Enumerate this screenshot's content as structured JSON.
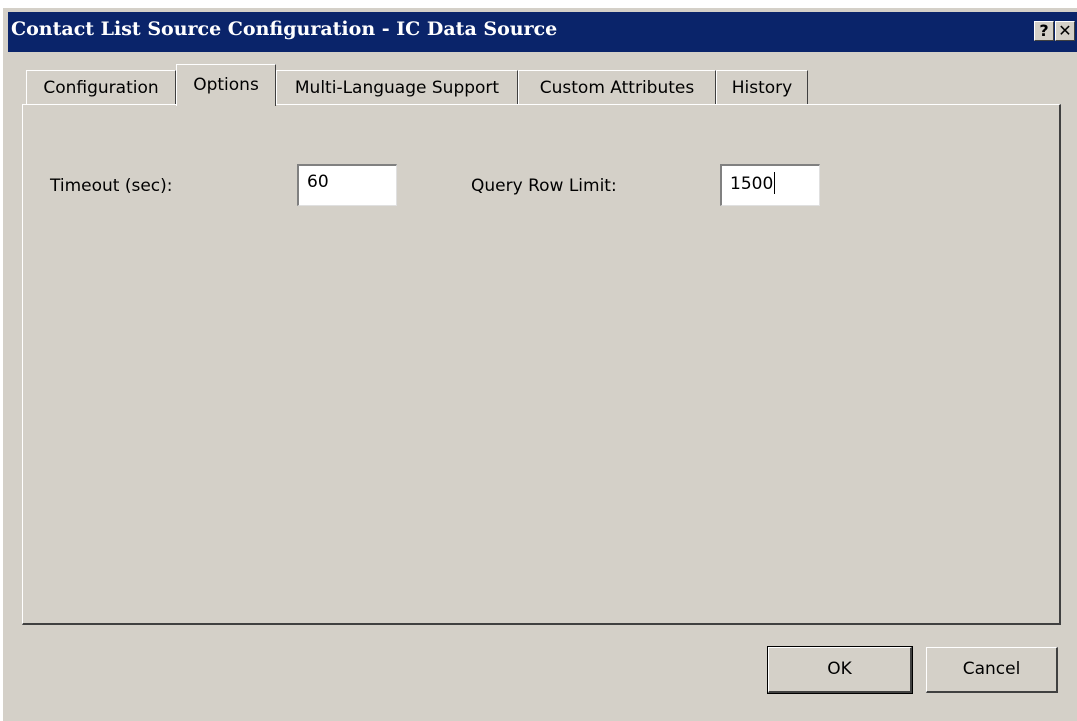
{
  "window": {
    "title": "Contact List Source Configuration - IC Data Source",
    "help_glyph": "?",
    "close_glyph": "✕"
  },
  "tabs": [
    {
      "label": "Configuration",
      "active": false
    },
    {
      "label": "Options",
      "active": true
    },
    {
      "label": "Multi-Language Support",
      "active": false
    },
    {
      "label": "Custom Attributes",
      "active": false
    },
    {
      "label": "History",
      "active": false
    }
  ],
  "options": {
    "timeout_label": "Timeout (sec):",
    "timeout_value": "60",
    "row_limit_label": "Query Row Limit:",
    "row_limit_value": "1500"
  },
  "buttons": {
    "ok": "OK",
    "cancel": "Cancel"
  }
}
